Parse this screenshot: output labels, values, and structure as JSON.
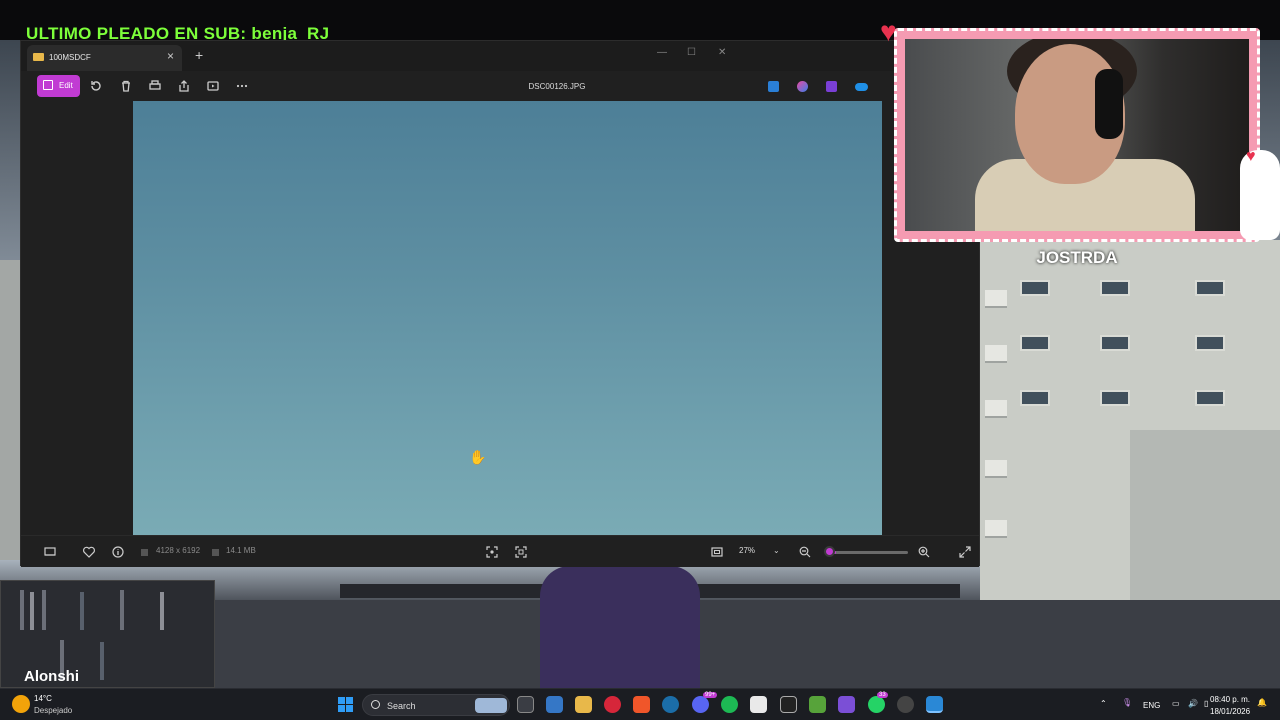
{
  "stream": {
    "top_banner": "ULTIMO PLEADO EN SUB: benja_RJ",
    "streamer_name": "Alonshi",
    "webcam_name": "JOSTRDA"
  },
  "photos_app": {
    "tab_label": "100MSDCF",
    "edit_label": "Edit",
    "file_name": "DSC00126.JPG",
    "toolbar_icons": [
      "rotate-icon",
      "delete-icon",
      "print-icon",
      "share-icon",
      "slideshow-icon",
      "more-icon"
    ],
    "app_icons": [
      "designer-icon",
      "copilot-icon",
      "clipchamp-icon",
      "onedrive-icon"
    ],
    "status": {
      "dimensions": "4128 x 6192",
      "file_size": "14.1 MB",
      "zoom": "27%",
      "zoom_level": 0.27
    }
  },
  "taskbar": {
    "weather_temp": "14°C",
    "weather_desc": "Despejado",
    "search_label": "Search",
    "badges": [
      "99+",
      "33"
    ],
    "language": "ENG",
    "time": "08:40 p. m.",
    "date": "18/01/2026"
  }
}
